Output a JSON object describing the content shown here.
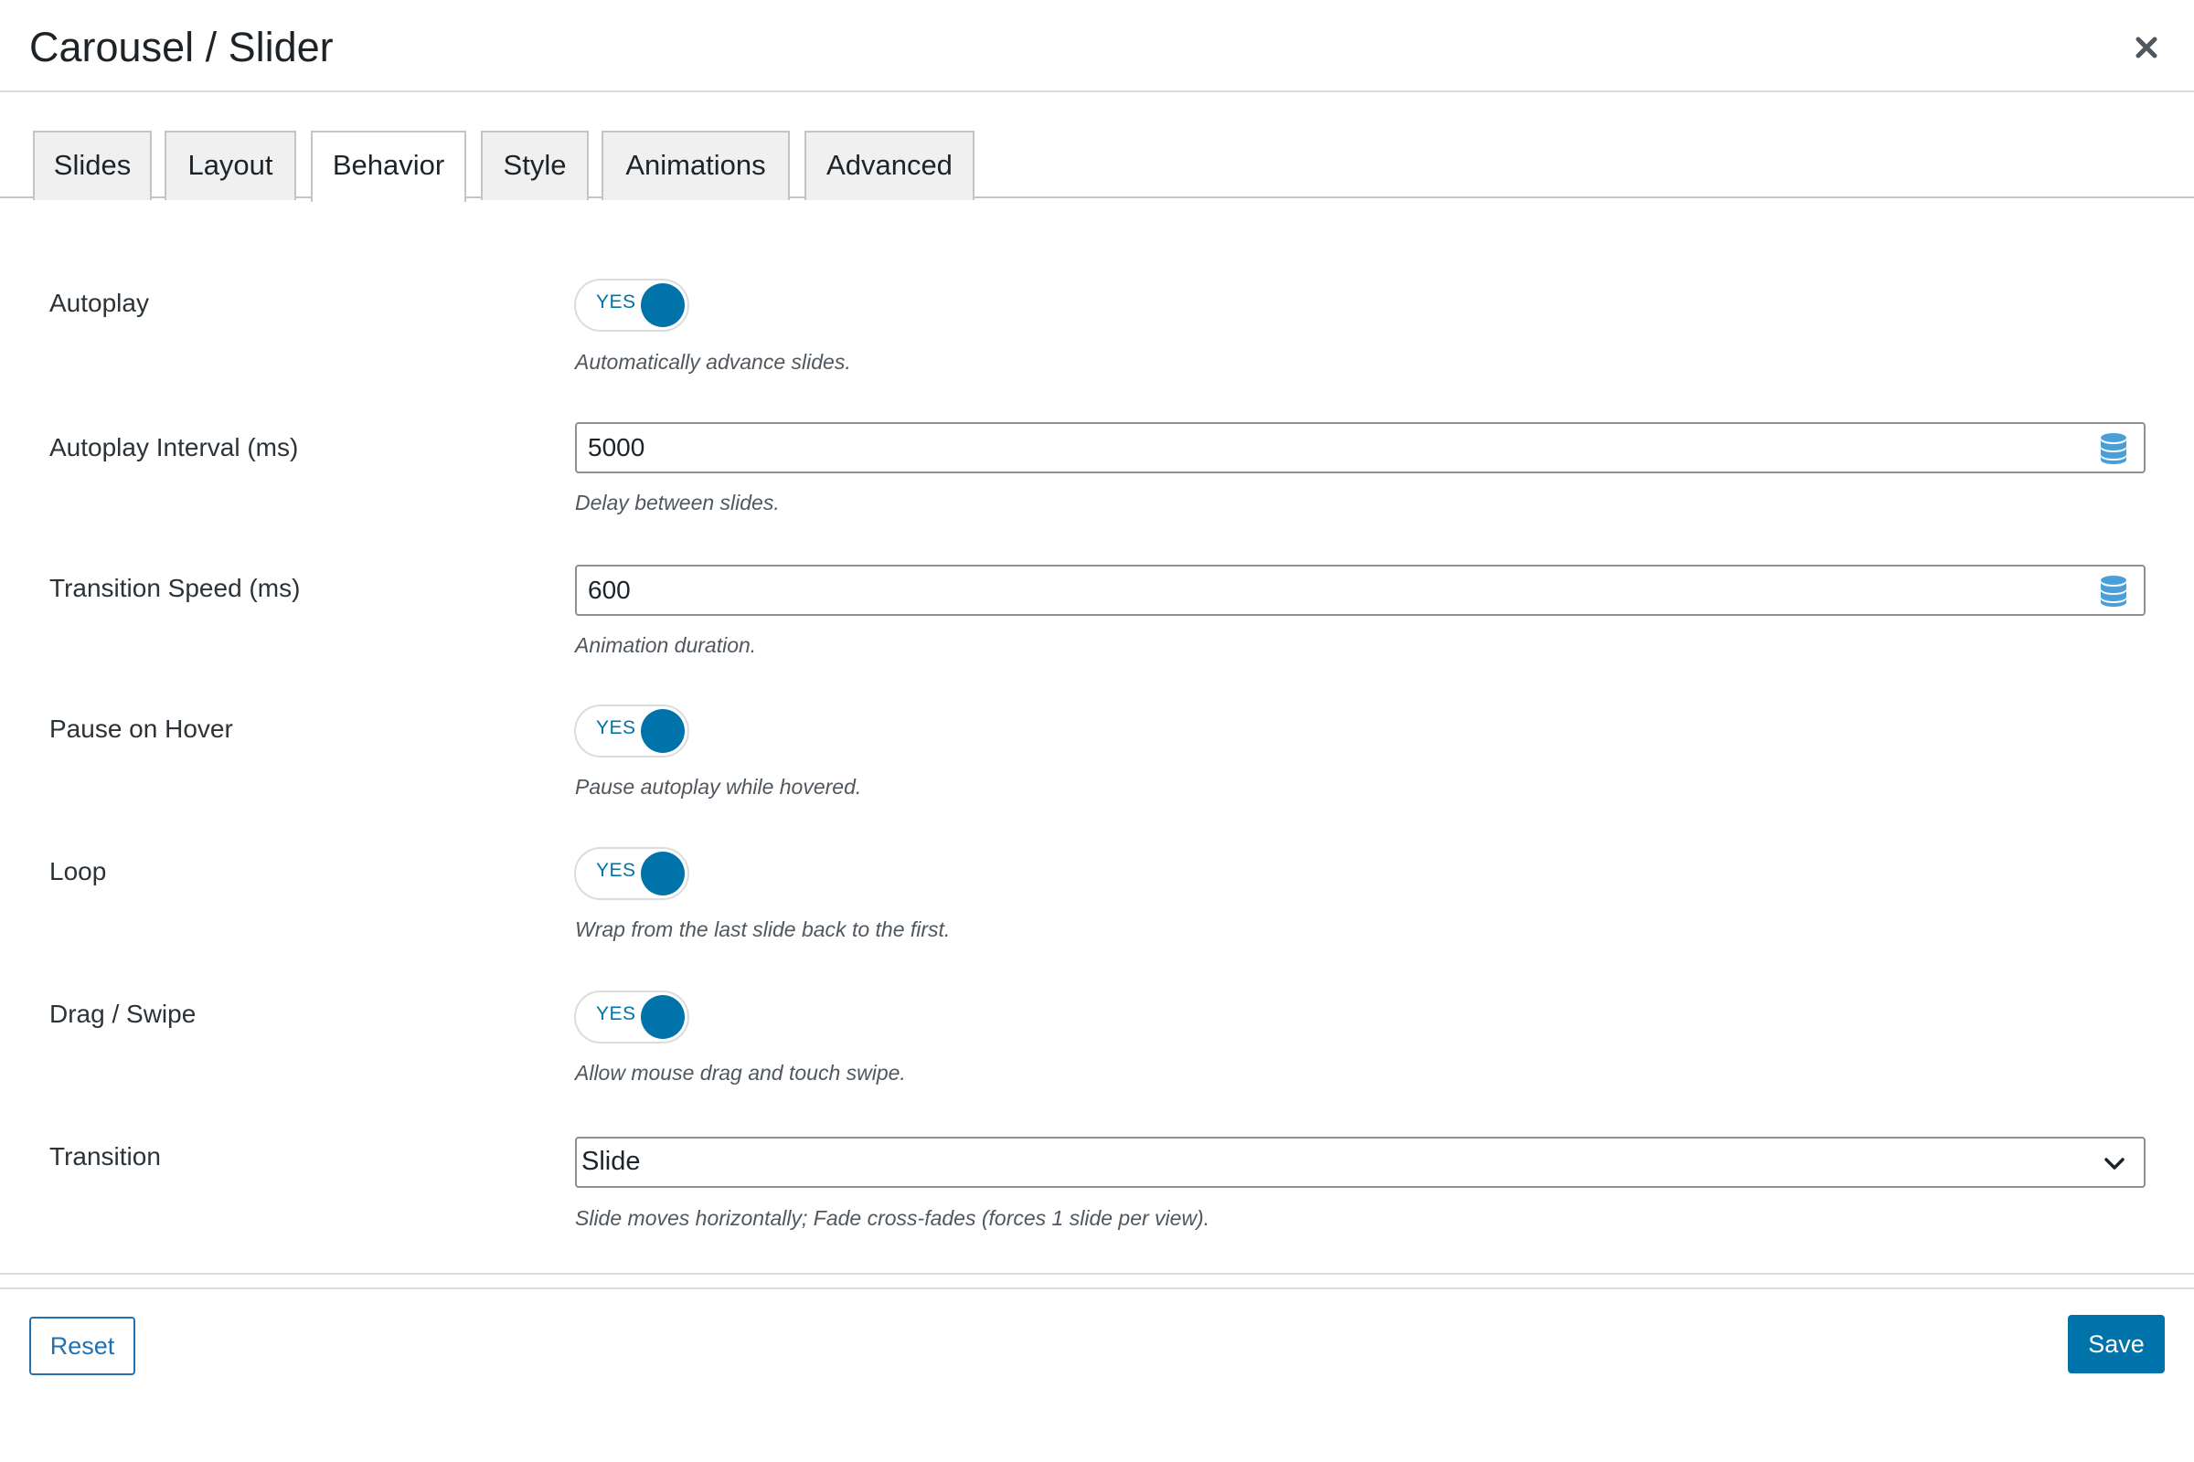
{
  "modal": {
    "title": "Carousel / Slider"
  },
  "tabs": [
    {
      "label": "Slides"
    },
    {
      "label": "Layout"
    },
    {
      "label": "Behavior",
      "active": true
    },
    {
      "label": "Style"
    },
    {
      "label": "Animations"
    },
    {
      "label": "Advanced"
    }
  ],
  "settings": {
    "autoplay": {
      "label": "Autoplay",
      "toggle": "YES",
      "help": "Automatically advance slides."
    },
    "autoplay_interval": {
      "label": "Autoplay Interval (ms)",
      "value": "5000",
      "help": "Delay between slides."
    },
    "transition_speed": {
      "label": "Transition Speed (ms)",
      "value": "600",
      "help": "Animation duration."
    },
    "pause_on_hover": {
      "label": "Pause on Hover",
      "toggle": "YES",
      "help": "Pause autoplay while hovered."
    },
    "loop": {
      "label": "Loop",
      "toggle": "YES",
      "help": "Wrap from the last slide back to the first."
    },
    "drag_swipe": {
      "label": "Drag / Swipe",
      "toggle": "YES",
      "help": "Allow mouse drag and touch swipe."
    },
    "transition": {
      "label": "Transition",
      "value": "Slide",
      "help": "Slide moves horizontally; Fade cross-fades (forces 1 slide per view)."
    }
  },
  "footer": {
    "reset_label": "Reset",
    "save_label": "Save"
  },
  "icons": {
    "close": "close-icon",
    "dynamic_data": "database-icon",
    "dropdown": "chevron-down-icon"
  },
  "colors": {
    "accent": "#0073aa",
    "button_outline": "#2271b1",
    "border": "#8c8f94",
    "tab_inactive_bg": "#f0f0f1"
  }
}
